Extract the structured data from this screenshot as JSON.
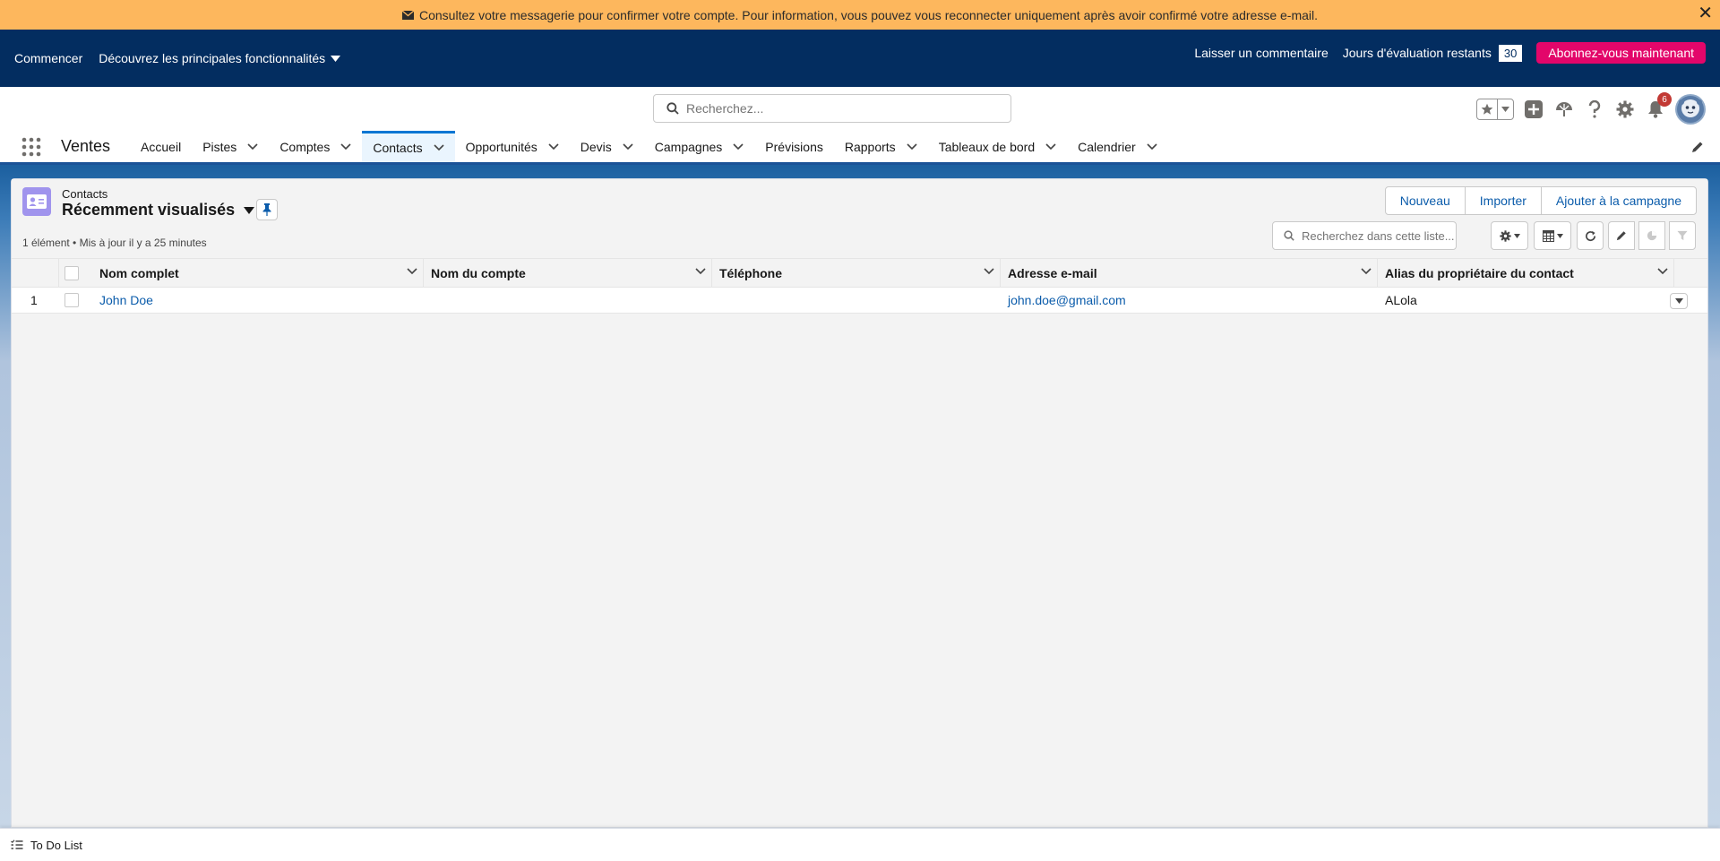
{
  "banner": {
    "message": "Consultez votre messagerie pour confirmer votre compte. Pour information, vous pouvez vous reconnecter uniquement après avoir confirmé votre adresse e-mail.",
    "close": "✕"
  },
  "trial": {
    "getting_started": "Commencer",
    "discover": "Découvrez les principales fonctionnalités",
    "feedback": "Laisser un commentaire",
    "days_label": "Jours d'évaluation restants",
    "days_value": "30",
    "subscribe": "Abonnez-vous maintenant"
  },
  "header": {
    "search_placeholder": "Recherchez...",
    "notification_count": "6"
  },
  "nav": {
    "app_name": "Ventes",
    "items": [
      {
        "label": "Accueil"
      },
      {
        "label": "Pistes"
      },
      {
        "label": "Comptes"
      },
      {
        "label": "Contacts"
      },
      {
        "label": "Opportunités"
      },
      {
        "label": "Devis"
      },
      {
        "label": "Campagnes"
      },
      {
        "label": "Prévisions"
      },
      {
        "label": "Rapports"
      },
      {
        "label": "Tableaux de bord"
      },
      {
        "label": "Calendrier"
      }
    ]
  },
  "list": {
    "object_label": "Contacts",
    "view_name": "Récemment visualisés",
    "meta": "1 élément • Mis à jour il y a 25 minutes",
    "buttons": {
      "new": "Nouveau",
      "import": "Importer",
      "add_campaign": "Ajouter à la campagne"
    },
    "search_placeholder": "Recherchez dans cette liste...",
    "columns": [
      "Nom complet",
      "Nom du compte",
      "Téléphone",
      "Adresse e-mail",
      "Alias du propriétaire du contact"
    ],
    "rows": [
      {
        "num": "1",
        "name": "John Doe",
        "account": "",
        "phone": "",
        "email": "john.doe@gmail.com",
        "owner": "ALola"
      }
    ]
  },
  "utility": {
    "todo": "To Do List"
  },
  "colors": {
    "banner": "#fdb75d",
    "trial_bar": "#032d60",
    "subscribe": "#e3066a",
    "link": "#0b5cab",
    "object_icon": "#a094ed"
  }
}
